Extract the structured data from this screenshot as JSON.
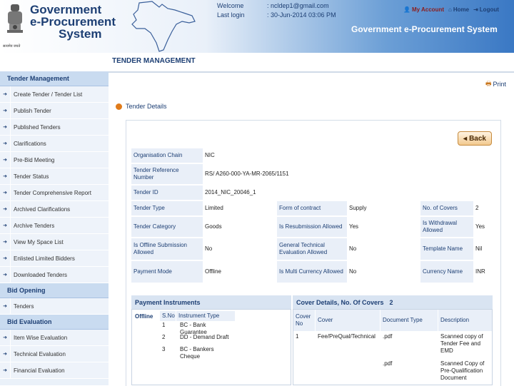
{
  "header": {
    "logo_line1": "Government",
    "logo_line2": "e-Procurement",
    "logo_line3": "System",
    "emblem_caption": "सत्यमेव जयते",
    "welcome_label": "Welcome",
    "welcome_value": ": ncldep1@gmail.com",
    "lastlogin_label": "Last login",
    "lastlogin_value": ": 30-Jun-2014 03:06 PM",
    "my_account": "My Account",
    "home": "Home",
    "logout": "Logout",
    "banner": "Government e-Procurement System"
  },
  "sidebar": {
    "sections": [
      {
        "title": "Tender Management",
        "items": [
          "Create Tender / Tender List",
          "Publish Tender",
          "Published Tenders",
          "Clarifications",
          "Pre-Bid Meeting",
          "Tender Status",
          "Tender Comprehensive Report",
          "Archived Clarifications",
          "Archive Tenders",
          "View My Space List",
          "Enlisted Limited Bidders",
          "Downloaded Tenders"
        ]
      },
      {
        "title": "Bid Opening",
        "items": [
          "Tenders"
        ]
      },
      {
        "title": "Bid Evaluation",
        "items": [
          "Item Wise Evaluation",
          "Technical Evaluation",
          "Financial Evaluation"
        ]
      }
    ]
  },
  "main": {
    "section_title": "TENDER MANAGEMENT",
    "print_label": "Print",
    "tender_details_title": "Tender Details",
    "back_label": "Back",
    "fields": {
      "org_chain_label": "Organisation Chain",
      "org_chain_value": "NIC",
      "tender_ref_label": "Tender Reference Number",
      "tender_ref_value": "RS/ A260-000-YA-MR-2065/1151",
      "tender_id_label": "Tender ID",
      "tender_id_value": "2014_NIC_20046_1",
      "tender_type_label": "Tender Type",
      "tender_type_value": "Limited",
      "form_contract_label": "Form of contract",
      "form_contract_value": "Supply",
      "no_covers_label": "No. of Covers",
      "no_covers_value": "2",
      "tender_category_label": "Tender Category",
      "tender_category_value": "Goods",
      "resubmission_label": "Is Resubmission Allowed",
      "resubmission_value": "Yes",
      "withdrawal_label": "Is Withdrawal Allowed",
      "withdrawal_value": "Yes",
      "offline_submission_label": "Is Offline Submission Allowed",
      "offline_submission_value": "No",
      "general_tech_label": "General Technical Evaluation Allowed",
      "general_tech_value": "No",
      "template_label": "Template Name",
      "template_value": "Nil",
      "payment_mode_label": "Payment Mode",
      "payment_mode_value": "Offline",
      "multi_currency_label": "Is Multi Currency Allowed",
      "multi_currency_value": "No",
      "currency_label": "Currency Name",
      "currency_value": "INR"
    },
    "payment": {
      "title": "Payment Instruments",
      "offline_label": "Offline",
      "col_sno": "S.No",
      "col_instrument": "Instrument Type",
      "rows": [
        {
          "sno": "1",
          "type": "BC - Bank Guarantee"
        },
        {
          "sno": "2",
          "type": "DD - Demand Draft"
        },
        {
          "sno": "3",
          "type": "BC - Bankers Cheque"
        }
      ]
    },
    "covers": {
      "title": "Cover Details, No. Of Covers",
      "count": "2",
      "col_no": "Cover No",
      "col_cover": "Cover",
      "col_doctype": "Document Type",
      "col_desc": "Description",
      "rows": [
        {
          "no": "1",
          "cover": "Fee/PreQual/Technical",
          "doctype": ".pdf",
          "desc": "Scanned copy of Tender Fee and EMD"
        },
        {
          "no": "",
          "cover": "",
          "doctype": ".pdf",
          "desc": "Scanned Copy of Pre-Qualification Document"
        }
      ]
    }
  }
}
